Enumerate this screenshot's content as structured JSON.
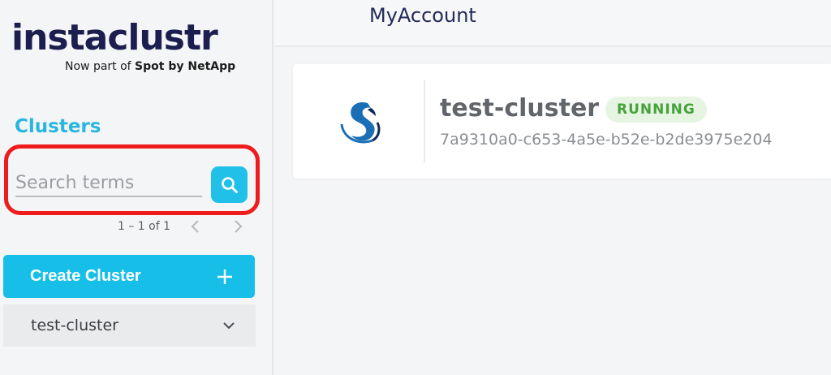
{
  "brand": {
    "name": "instaclustr",
    "tagline_prefix": "Now part of ",
    "tagline_bold": "Spot by NetApp"
  },
  "header": {
    "title": "MyAccount"
  },
  "sidebar": {
    "section_title": "Clusters",
    "search": {
      "placeholder": "Search terms",
      "value": ""
    },
    "pagination": {
      "text": "1 – 1 of 1"
    },
    "create_button_label": "Create Cluster",
    "items": [
      {
        "label": "test-cluster"
      }
    ]
  },
  "main": {
    "cluster_card": {
      "name": "test-cluster",
      "status": "RUNNING",
      "id": "7a9310a0-c653-4a5e-b52e-b2de3975e204",
      "logo_icon": "instaclustr-cluster-icon"
    }
  },
  "colors": {
    "accent": "#17bfe8",
    "brand_navy": "#1c1e4f",
    "status_running_bg": "#e5f5e2",
    "status_running_text": "#47a13c",
    "highlight_border": "#ee1c1c"
  }
}
